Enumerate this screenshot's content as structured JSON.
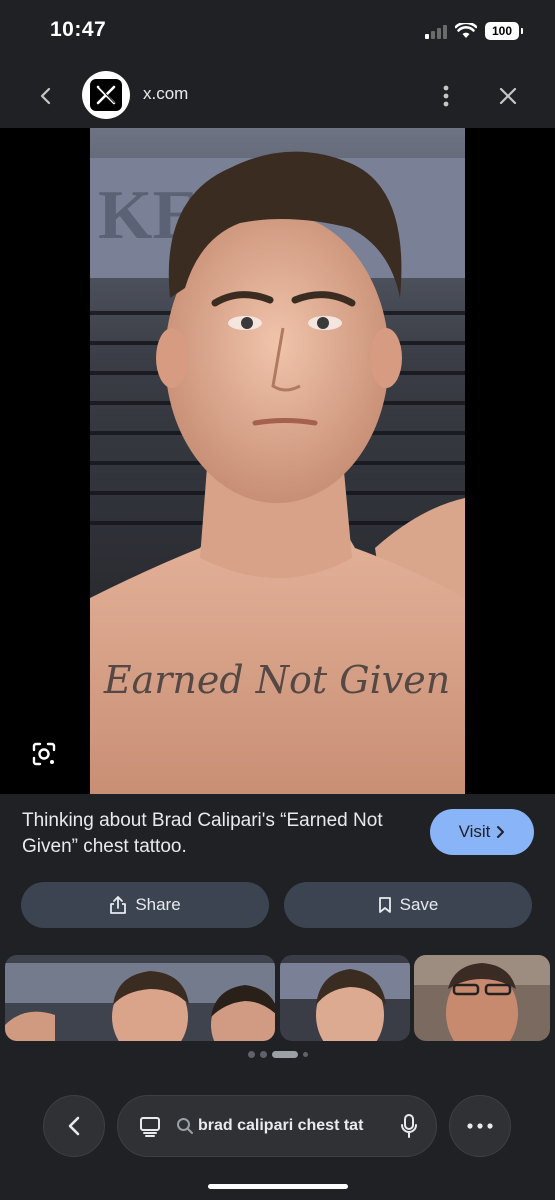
{
  "status": {
    "time": "10:47",
    "battery": "100"
  },
  "header": {
    "site": "x.com"
  },
  "caption": "Thinking about Brad Calipari's “Earned Not Given” chest tattoo.",
  "photo": {
    "tattoo_text": "Earned Not Given",
    "banner_letters": "KE"
  },
  "actions": {
    "visit": "Visit",
    "share": "Share",
    "save": "Save"
  },
  "search": {
    "query": "brad calipari chest tat"
  },
  "colors": {
    "accent": "#8ab4f8",
    "background": "#202124",
    "button": "#3c4452"
  },
  "carousel": {
    "count": 4,
    "active": 2
  }
}
